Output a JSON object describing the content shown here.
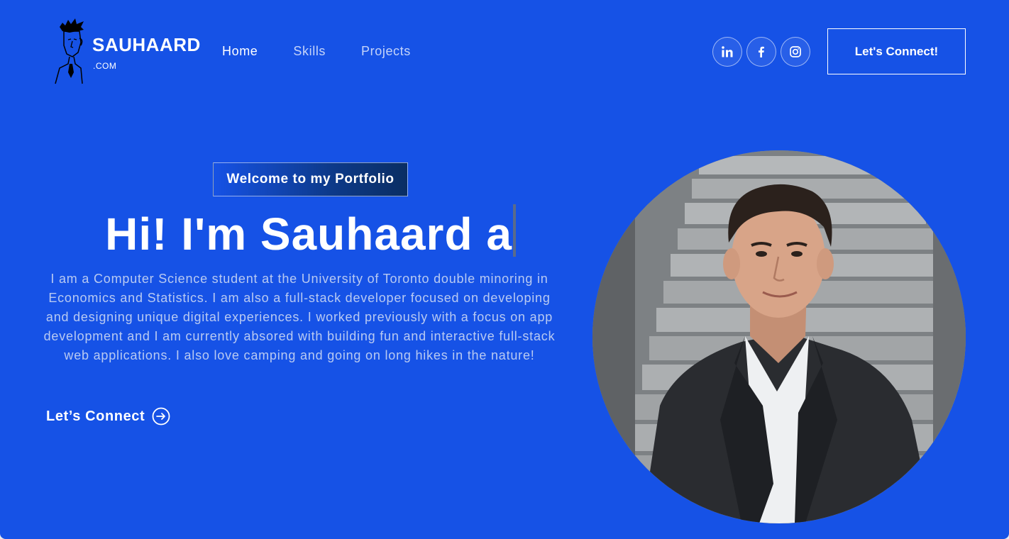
{
  "brand": {
    "name": "SAUHAARD",
    "suffix": ".COM"
  },
  "nav": {
    "items": [
      {
        "label": "Home",
        "active": true
      },
      {
        "label": "Skills",
        "active": false
      },
      {
        "label": "Projects",
        "active": false
      }
    ]
  },
  "socials": [
    {
      "icon": "linkedin-icon"
    },
    {
      "icon": "facebook-icon"
    },
    {
      "icon": "instagram-icon"
    }
  ],
  "header": {
    "connect_label": "Let's Connect!"
  },
  "hero": {
    "tagline": "Welcome to my Portfolio",
    "headline": "Hi! I'm Sauhaard a",
    "bio": "I am a Computer Science student at the University of Toronto double minoring in Economics and Statistics. I am also a full-stack developer focused on developing and designing unique digital experiences. I worked previously with a focus on app development and I am currently absored with building fun and interactive full-stack web applications. I also love camping and going on long hikes in the nature!",
    "cta_label": "Let’s Connect",
    "cta_icon": "arrow-right-circle-icon"
  },
  "portrait": {
    "subject": "portrait-photo"
  },
  "colors": {
    "background": "#1652e6",
    "text": "#ffffff",
    "muted_text": "#e6eaf5",
    "tagline_gradient_end": "#0a2e63"
  }
}
